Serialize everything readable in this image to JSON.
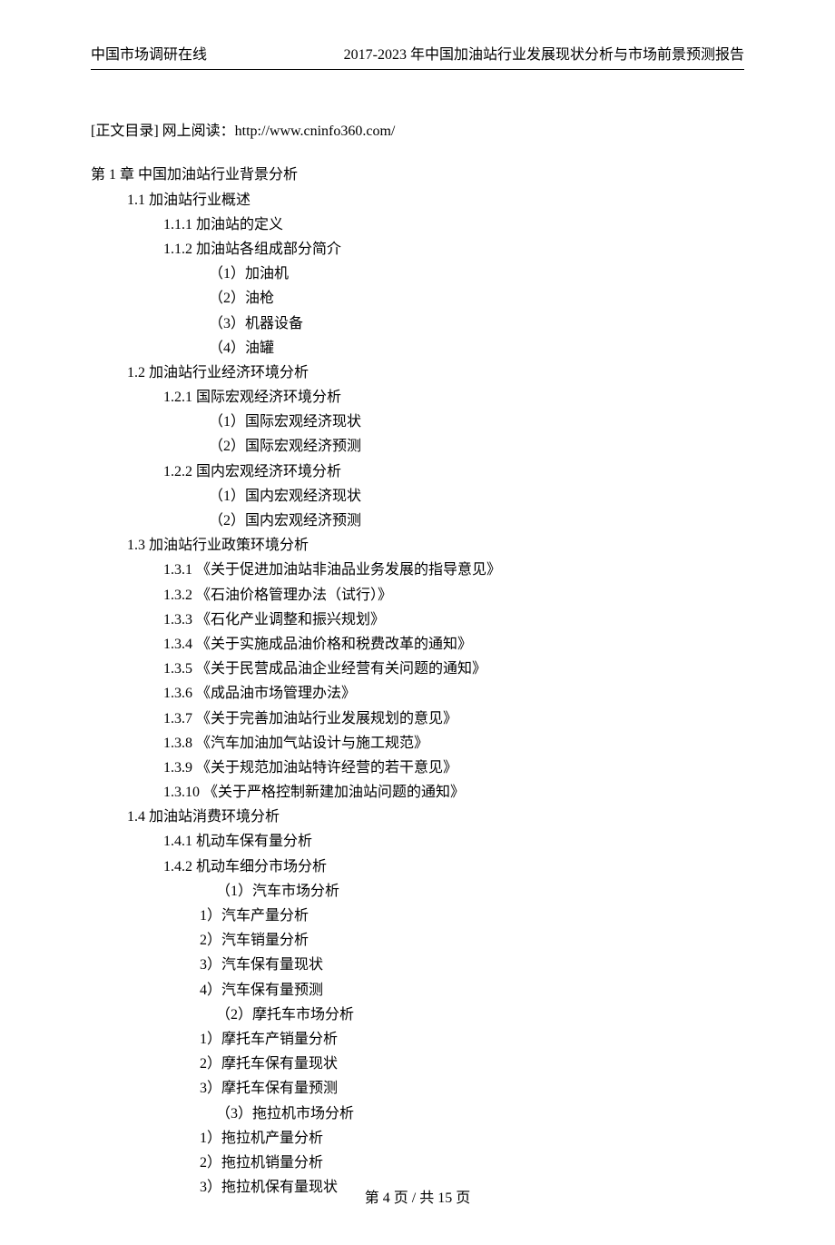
{
  "header": {
    "left": "中国市场调研在线",
    "right": "2017-2023 年中国加油站行业发展现状分析与市场前景预测报告"
  },
  "intro": {
    "label": "[正文目录] 网上阅读：http://www.cninfo360.com/"
  },
  "toc": [
    {
      "lvl": 0,
      "text": "第 1 章  中国加油站行业背景分析"
    },
    {
      "lvl": 1,
      "text": "1.1 加油站行业概述"
    },
    {
      "lvl": 2,
      "text": "1.1.1 加油站的定义"
    },
    {
      "lvl": 2,
      "text": "1.1.2 加油站各组成部分简介"
    },
    {
      "lvl": 3,
      "text": "（1）加油机"
    },
    {
      "lvl": 3,
      "text": "（2）油枪"
    },
    {
      "lvl": 3,
      "text": "（3）机器设备"
    },
    {
      "lvl": 3,
      "text": "（4）油罐"
    },
    {
      "lvl": 1,
      "text": "1.2 加油站行业经济环境分析"
    },
    {
      "lvl": 2,
      "text": "1.2.1 国际宏观经济环境分析"
    },
    {
      "lvl": 3,
      "text": "（1）国际宏观经济现状"
    },
    {
      "lvl": 3,
      "text": "（2）国际宏观经济预测"
    },
    {
      "lvl": 2,
      "text": "1.2.2 国内宏观经济环境分析"
    },
    {
      "lvl": 3,
      "text": "（1）国内宏观经济现状"
    },
    {
      "lvl": 3,
      "text": "（2）国内宏观经济预测"
    },
    {
      "lvl": 1,
      "text": "1.3 加油站行业政策环境分析"
    },
    {
      "lvl": 2,
      "text": "1.3.1 《关于促进加油站非油品业务发展的指导意见》"
    },
    {
      "lvl": 2,
      "text": "1.3.2 《石油价格管理办法（试行）》"
    },
    {
      "lvl": 2,
      "text": "1.3.3 《石化产业调整和振兴规划》"
    },
    {
      "lvl": 2,
      "text": "1.3.4 《关于实施成品油价格和税费改革的通知》"
    },
    {
      "lvl": 2,
      "text": "1.3.5 《关于民营成品油企业经营有关问题的通知》"
    },
    {
      "lvl": 2,
      "text": "1.3.6 《成品油市场管理办法》"
    },
    {
      "lvl": 2,
      "text": "1.3.7 《关于完善加油站行业发展规划的意见》"
    },
    {
      "lvl": 2,
      "text": "1.3.8 《汽车加油加气站设计与施工规范》"
    },
    {
      "lvl": 2,
      "text": "1.3.9 《关于规范加油站特许经营的若干意见》"
    },
    {
      "lvl": 2,
      "text": "1.3.10 《关于严格控制新建加油站问题的通知》"
    },
    {
      "lvl": 1,
      "text": "1.4 加油站消费环境分析"
    },
    {
      "lvl": 2,
      "text": "1.4.1 机动车保有量分析"
    },
    {
      "lvl": 2,
      "text": "1.4.2 机动车细分市场分析"
    },
    {
      "lvl": "3b",
      "text": "（1）汽车市场分析"
    },
    {
      "lvl": 4,
      "text": "1）汽车产量分析"
    },
    {
      "lvl": 4,
      "text": "2）汽车销量分析"
    },
    {
      "lvl": 4,
      "text": "3）汽车保有量现状"
    },
    {
      "lvl": 4,
      "text": "4）汽车保有量预测"
    },
    {
      "lvl": "3b",
      "text": "（2）摩托车市场分析"
    },
    {
      "lvl": 4,
      "text": "1）摩托车产销量分析"
    },
    {
      "lvl": 4,
      "text": "2）摩托车保有量现状"
    },
    {
      "lvl": 4,
      "text": "3）摩托车保有量预测"
    },
    {
      "lvl": "3b",
      "text": "（3）拖拉机市场分析"
    },
    {
      "lvl": 4,
      "text": "1）拖拉机产量分析"
    },
    {
      "lvl": 4,
      "text": "2）拖拉机销量分析"
    },
    {
      "lvl": 4,
      "text": "3）拖拉机保有量现状"
    }
  ],
  "footer": {
    "text": "第 4 页 / 共 15 页"
  }
}
